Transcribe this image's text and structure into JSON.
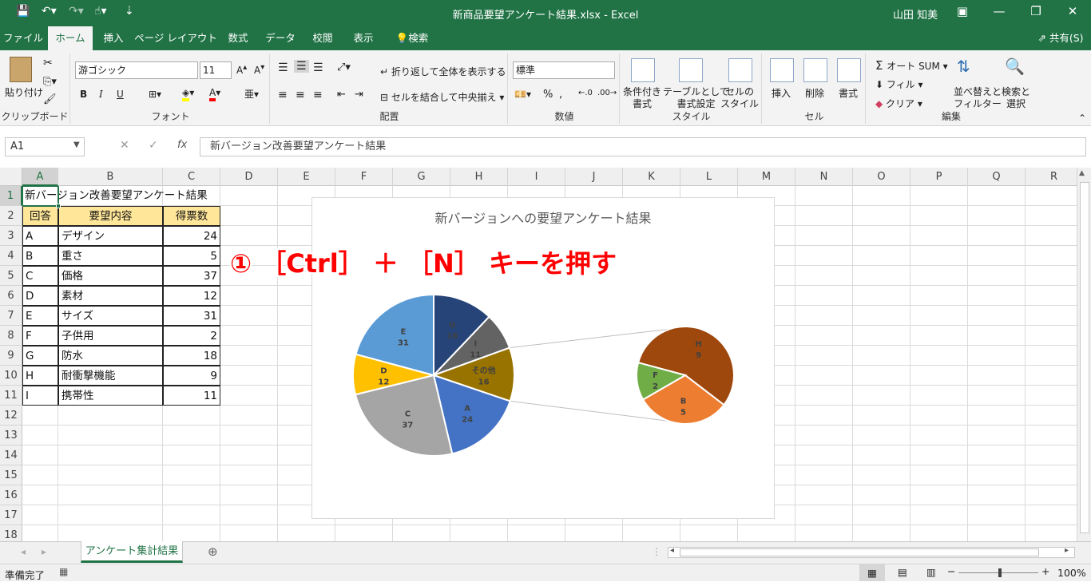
{
  "titlebar": {
    "title": "新商品要望アンケート結果.xlsx  -  Excel",
    "user": "山田 知美"
  },
  "tabs": [
    "ファイル",
    "ホーム",
    "挿入",
    "ページ レイアウト",
    "数式",
    "データ",
    "校閲",
    "表示",
    "検索"
  ],
  "share_label": "共有(S)",
  "ribbon": {
    "clipboard": {
      "paste": "貼り付け",
      "label": "クリップボード"
    },
    "font": {
      "name": "游ゴシック",
      "size": "11",
      "bold": "B",
      "italic": "I",
      "underline": "U",
      "label": "フォント"
    },
    "alignment": {
      "wrap": "折り返して全体を表示する",
      "merge": "セルを結合して中央揃え",
      "label": "配置"
    },
    "number": {
      "format": "標準",
      "label": "数値"
    },
    "styles": {
      "conditional": [
        "条件付き",
        "書式"
      ],
      "table": [
        "テーブルとして",
        "書式設定"
      ],
      "cell": [
        "セルの",
        "スタイル"
      ],
      "label": "スタイル"
    },
    "cells": {
      "insert": "挿入",
      "delete": "削除",
      "format": "書式",
      "label": "セル"
    },
    "editing": {
      "autosum": "オート SUM",
      "fill": "フィル",
      "clear": "クリア",
      "sort": [
        "並べ替えと",
        "フィルター"
      ],
      "find": [
        "検索と",
        "選択"
      ],
      "label": "編集"
    }
  },
  "formula_bar": {
    "name_box": "A1",
    "content": "新バージョン改善要望アンケート結果"
  },
  "columns": [
    "A",
    "B",
    "C",
    "D",
    "E",
    "F",
    "G",
    "H",
    "I",
    "J",
    "K",
    "L",
    "M",
    "N",
    "O",
    "P",
    "Q",
    "R"
  ],
  "rows": [
    "1",
    "2",
    "3",
    "4",
    "5",
    "6",
    "7",
    "8",
    "9",
    "10",
    "11",
    "12",
    "13",
    "14",
    "15",
    "16",
    "17",
    "18"
  ],
  "sheet": {
    "title": "新バージョン改善要望アンケート結果",
    "headers": [
      "回答",
      "要望内容",
      "得票数"
    ],
    "data": [
      [
        "A",
        "デザイン",
        "24"
      ],
      [
        "B",
        "重さ",
        "5"
      ],
      [
        "C",
        "価格",
        "37"
      ],
      [
        "D",
        "素材",
        "12"
      ],
      [
        "E",
        "サイズ",
        "31"
      ],
      [
        "F",
        "子供用",
        "2"
      ],
      [
        "G",
        "防水",
        "18"
      ],
      [
        "H",
        "耐衝撃機能",
        "9"
      ],
      [
        "I",
        "携帯性",
        "11"
      ]
    ]
  },
  "annotation": "① ［Ctrl］ ＋ ［N］ キーを押す",
  "chart_data": {
    "type": "pie",
    "title": "新バージョンへの要望アンケート結果",
    "main_pie": [
      {
        "label": "G",
        "value": 18,
        "color": "#264478"
      },
      {
        "label": "I",
        "value": 11,
        "color": "#636363"
      },
      {
        "label": "その他",
        "value": 16,
        "color": "#997300"
      },
      {
        "label": "A",
        "value": 24,
        "color": "#4472c4"
      },
      {
        "label": "C",
        "value": 37,
        "color": "#a5a5a5"
      },
      {
        "label": "D",
        "value": 12,
        "color": "#ffc000"
      },
      {
        "label": "E",
        "value": 31,
        "color": "#5b9bd5"
      }
    ],
    "sub_pie": [
      {
        "label": "H",
        "value": 9,
        "color": "#9e480e"
      },
      {
        "label": "B",
        "value": 5,
        "color": "#ed7d31"
      },
      {
        "label": "F",
        "value": 2,
        "color": "#70ad47"
      }
    ]
  },
  "sheet_tab": "アンケート集計結果",
  "status": {
    "ready": "準備完了",
    "zoom": "100%"
  }
}
